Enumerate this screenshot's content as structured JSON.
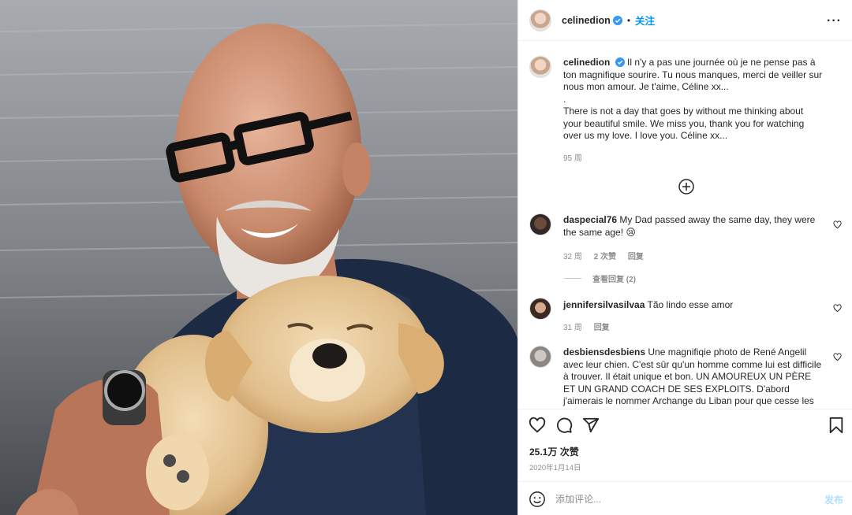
{
  "post": {
    "username": "celinedion",
    "follow_label": "关注",
    "dot": "•",
    "more": "···"
  },
  "caption": {
    "username": "celinedion",
    "text_fr": "Il n'y a pas une journée où je ne pense pas à ton magnifique sourire. Tu nous manques, merci de veiller sur nous mon amour. Je t'aime, Céline xx...",
    "separator": ".",
    "text_en": "There is not a day that goes by without me thinking about your beautiful smile. We miss you, thank you for watching over us my love. I love you. Céline xx...",
    "time": "95 周"
  },
  "comments": [
    {
      "username": "daspecial76",
      "text": "My Dad passed away the same day, they were the same age! 😢",
      "time": "32 周",
      "likes": "2 次赞",
      "reply": "回复",
      "view_replies": "查看回复 (2)"
    },
    {
      "username": "jennifersilvasilvaa",
      "text": "Tão lindo esse amor",
      "time": "31 周",
      "reply": "回复"
    },
    {
      "username": "desbiensdesbiens",
      "text": "Une magnifiqie photo de René Angelil avec leur chien. C'est sûr qu'un homme comme lui est difficile à trouver. Il était unique et bon. UN AMOUREUX UN PÈRE ET UN GRAND COACH DE SES EXPLOITS. D'abord j'aimerais le nommer Archange du Liban pour que cesse les conflits"
    }
  ],
  "stats": {
    "likes": "25.1万 次赞",
    "date": "2020年1月14日"
  },
  "compose": {
    "placeholder": "添加评论...",
    "post_label": "发布"
  },
  "icons": {
    "verified": "verified-badge-icon",
    "heart": "heart-icon",
    "comment": "comment-icon",
    "share": "share-icon",
    "save": "bookmark-icon",
    "emoji": "emoji-icon",
    "plus": "plus-circle-icon"
  },
  "colors": {
    "accent": "#0095f6",
    "muted": "#8e8e8e",
    "post_disabled": "#b2dffc"
  }
}
